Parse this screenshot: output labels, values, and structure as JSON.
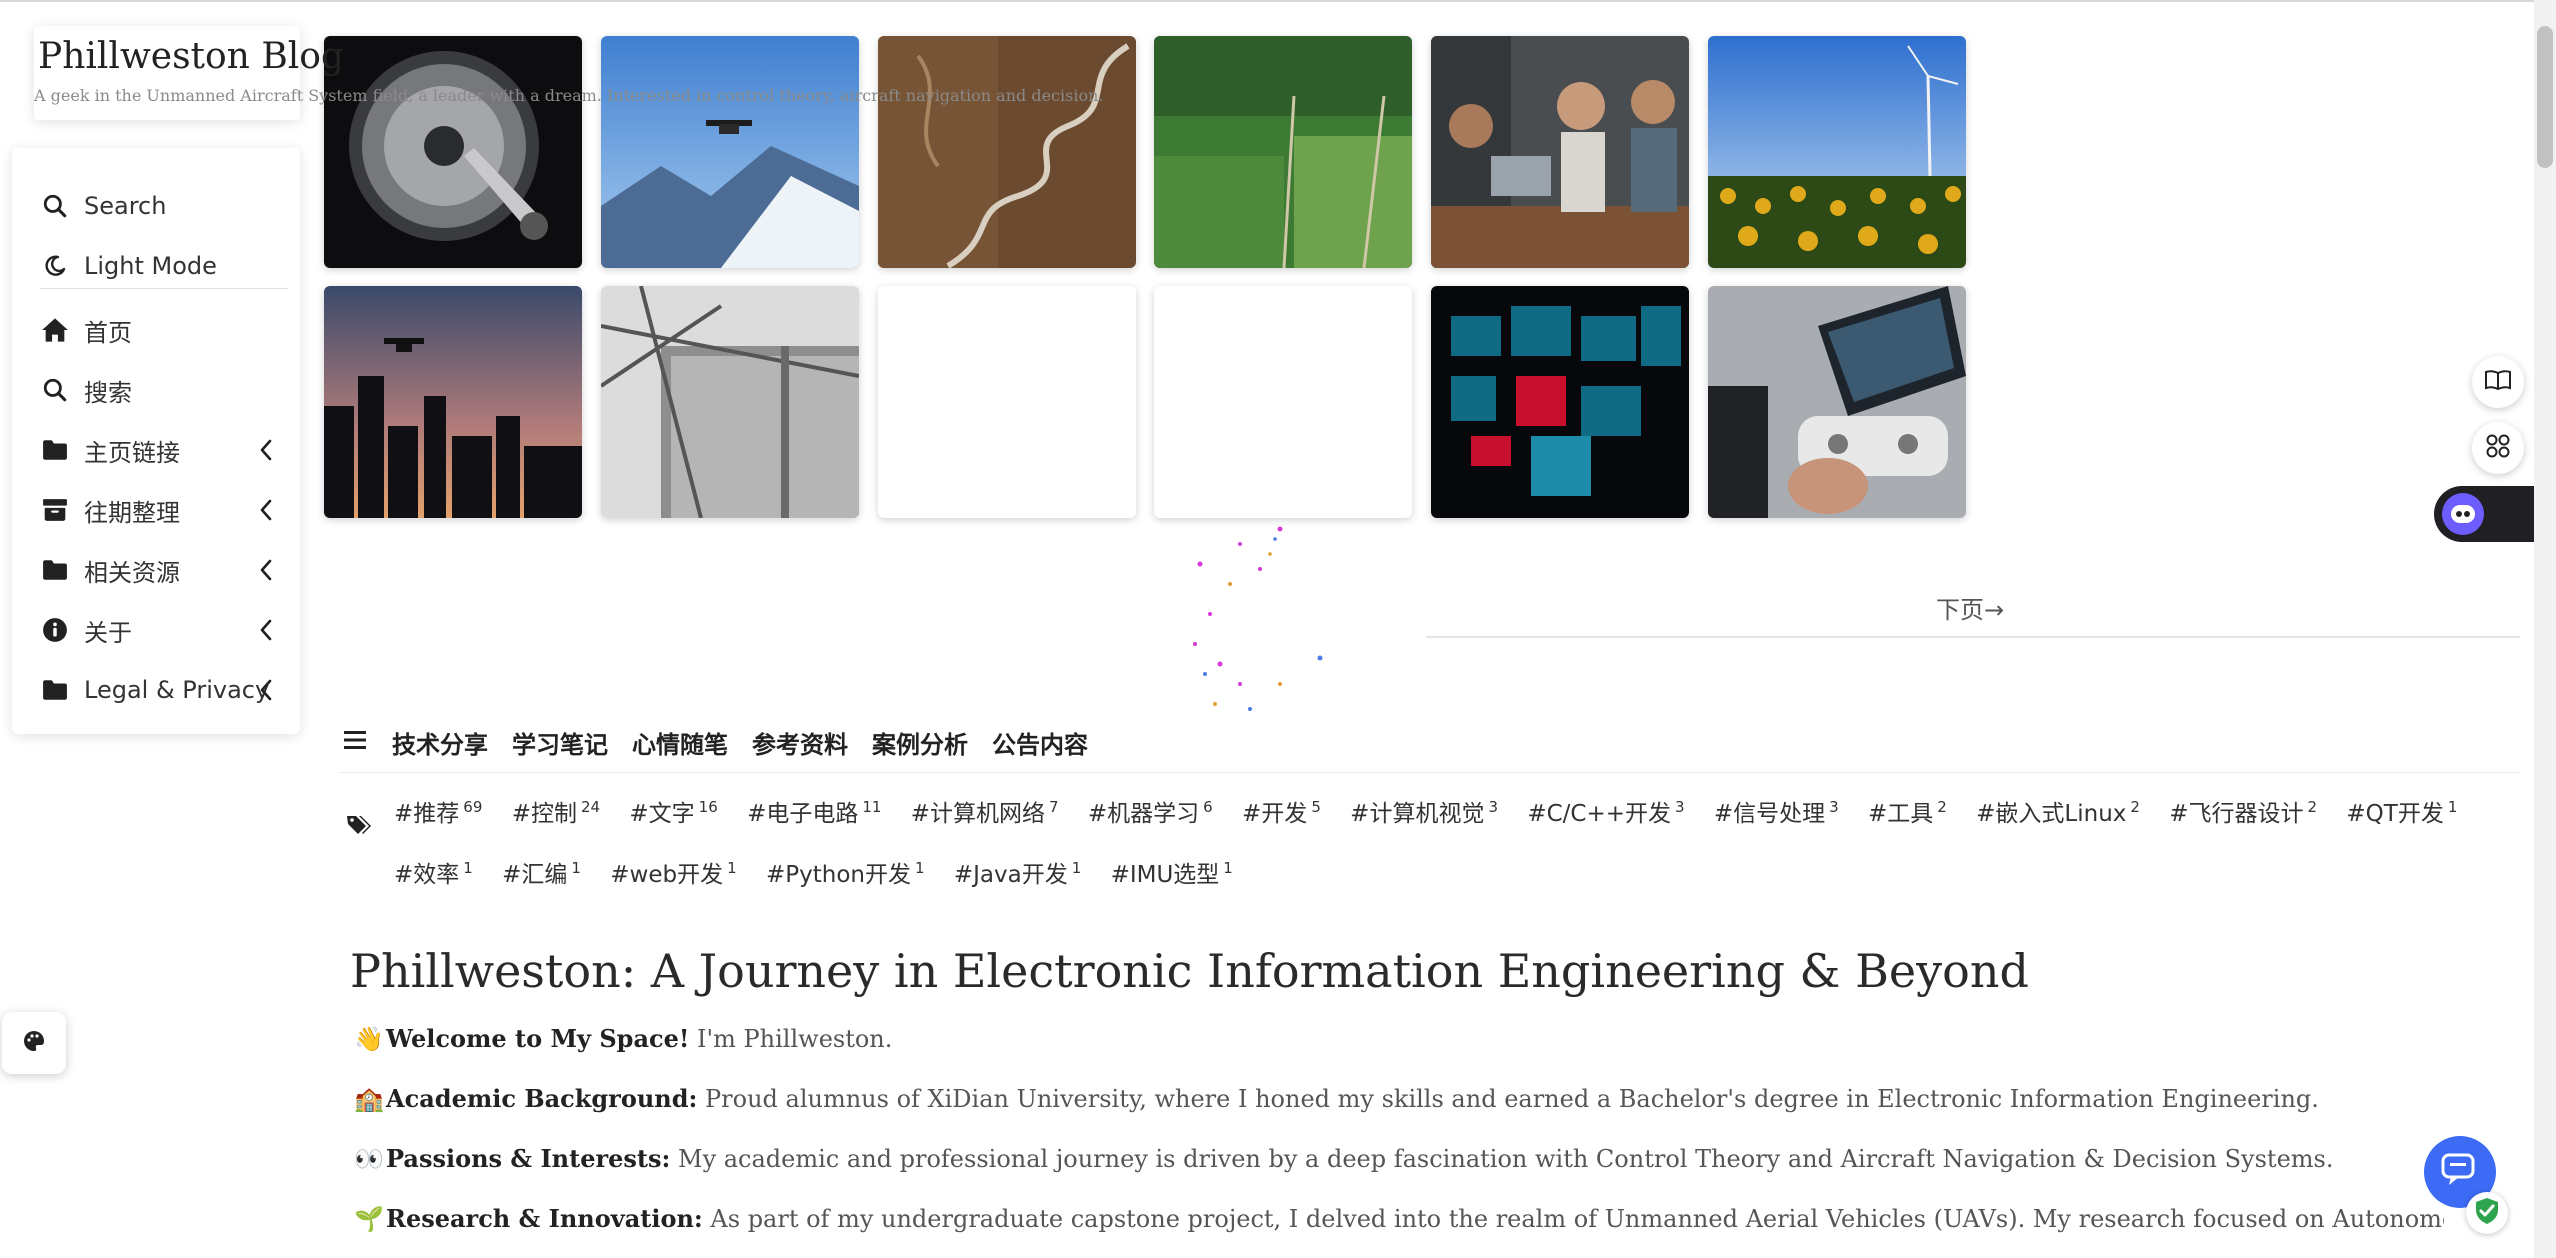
{
  "brand": {
    "title": "Phillweston Blog",
    "subtitle": "A geek in the Unmanned Aircraft System field, a leader with a dream. Interested in control theory, aircraft navigation and decision."
  },
  "menu": {
    "search": "Search",
    "theme": "Light Mode",
    "items": [
      {
        "label": "首页",
        "icon": "home-icon"
      },
      {
        "label": "搜索",
        "icon": "search-icon"
      },
      {
        "label": "主页链接",
        "icon": "folder-icon"
      },
      {
        "label": "往期整理",
        "icon": "archive-icon"
      },
      {
        "label": "相关资源",
        "icon": "folder-icon"
      },
      {
        "label": "关于",
        "icon": "info-icon"
      },
      {
        "label": "Legal & Privacy",
        "icon": "folder-icon"
      }
    ]
  },
  "thumbnails": [
    {
      "subject": "hard-drive"
    },
    {
      "subject": "drone-over-mountains"
    },
    {
      "subject": "winding-road"
    },
    {
      "subject": "aerial-farmland"
    },
    {
      "subject": "people-with-laptops"
    },
    {
      "subject": "sunflower-wind-turbine"
    },
    {
      "subject": "drone-city-skyline"
    },
    {
      "subject": "industrial-tank"
    },
    {
      "subject": "blank"
    },
    {
      "subject": "blank"
    },
    {
      "subject": "screens-dark-room"
    },
    {
      "subject": "drone-controller-tablet"
    }
  ],
  "pagination": {
    "next": "下页→"
  },
  "categories": [
    "技术分享",
    "学习笔记",
    "心情随笔",
    "参考资料",
    "案例分析",
    "公告内容"
  ],
  "tags": [
    {
      "name": "#推荐",
      "count": "69"
    },
    {
      "name": "#控制",
      "count": "24"
    },
    {
      "name": "#文字",
      "count": "16"
    },
    {
      "name": "#电子电路",
      "count": "11"
    },
    {
      "name": "#计算机网络",
      "count": "7"
    },
    {
      "name": "#机器学习",
      "count": "6"
    },
    {
      "name": "#开发",
      "count": "5"
    },
    {
      "name": "#计算机视觉",
      "count": "3"
    },
    {
      "name": "#C/C++开发",
      "count": "3"
    },
    {
      "name": "#信号处理",
      "count": "3"
    },
    {
      "name": "#工具",
      "count": "2"
    },
    {
      "name": "#嵌入式Linux",
      "count": "2"
    },
    {
      "name": "#飞行器设计",
      "count": "2"
    },
    {
      "name": "#QT开发",
      "count": "1"
    },
    {
      "name": "#效率",
      "count": "1"
    },
    {
      "name": "#汇编",
      "count": "1"
    },
    {
      "name": "#web开发",
      "count": "1"
    },
    {
      "name": "#Python开发",
      "count": "1"
    },
    {
      "name": "#Java开发",
      "count": "1"
    },
    {
      "name": "#IMU选型",
      "count": "1"
    }
  ],
  "article": {
    "title": "Phillweston: A Journey in Electronic Information Engineering & Beyond",
    "paragraphs": [
      {
        "emoji": "👋",
        "bold": "Welcome to My Space!",
        "text": " I'm Phillweston."
      },
      {
        "emoji": "🏫",
        "bold": "Academic Background:",
        "text": " Proud alumnus of XiDian University, where I honed my skills and earned a Bachelor's degree in Electronic Information Engineering."
      },
      {
        "emoji": "👀",
        "bold": "Passions & Interests:",
        "text": " My academic and professional journey is driven by a deep fascination with Control Theory and Aircraft Navigation & Decision Systems."
      },
      {
        "emoji": "🌱",
        "bold": "Research & Innovation:",
        "text": " As part of my undergraduate capstone project, I delved into the realm of Unmanned Aerial Vehicles (UAVs). My research focused on Autonomous Waypoint Flight an"
      }
    ]
  },
  "colors": {
    "accent": "#3d6bf5",
    "bot_tab": "#1f1f24",
    "shield": "#2ea44f"
  }
}
